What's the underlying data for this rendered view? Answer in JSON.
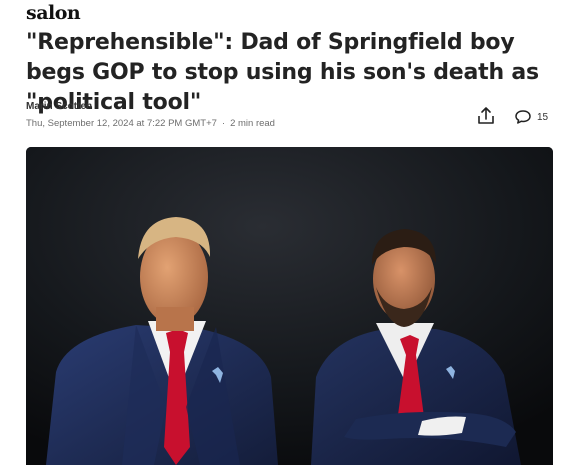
{
  "site": {
    "brand": "salon"
  },
  "article": {
    "headline": "\"Reprehensible\": Dad of Springfield boy begs GOP to stop using his son's death as \"political tool\"",
    "author": "Marin Scotten",
    "date": "Thu, September 12, 2024 at 7:22 PM GMT+7",
    "read_time": "2 min read",
    "separator": "·"
  },
  "actions": {
    "share_icon": "share-icon",
    "comment_icon": "comment-icon",
    "comment_count": "15"
  },
  "colors": {
    "background": "#ffffff",
    "headline": "#232323",
    "meta": "#6e6e6e",
    "tie_red": "#c8102e",
    "suit_navy": "#1c2a52"
  }
}
